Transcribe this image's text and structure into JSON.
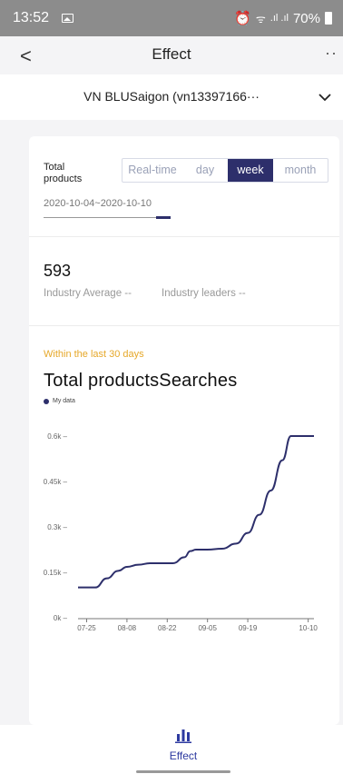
{
  "status_bar": {
    "time": "13:52",
    "battery": "70%"
  },
  "header": {
    "title": "Effect",
    "back_glyph": "<",
    "more_glyph": "··"
  },
  "store_selector": {
    "name": "VN BLUSaigon (vn13397166···"
  },
  "filter": {
    "label": "Total products",
    "tabs": [
      "Real-time",
      "day",
      "week",
      "month"
    ],
    "selected_tab": "week",
    "date_range": "2020-10-04~2020-10-10"
  },
  "stats": {
    "value": "593",
    "industry_average": "Industry Average --",
    "industry_leaders": "Industry leaders --"
  },
  "chart_section": {
    "period_note": "Within the last 30 days",
    "title": "Total productsSearches",
    "legend_label": "My data"
  },
  "chart_data": {
    "type": "line",
    "title": "Total productsSearches",
    "series": [
      {
        "name": "My data",
        "color": "#2d2f6b",
        "x": [
          "07-22",
          "07-25",
          "07-28",
          "08-01",
          "08-05",
          "08-08",
          "08-12",
          "08-16",
          "08-20",
          "08-24",
          "08-28",
          "08-30",
          "09-01",
          "09-05",
          "09-10",
          "09-15",
          "09-19",
          "09-23",
          "09-27",
          "10-01",
          "10-04",
          "10-07",
          "10-10",
          "10-12"
        ],
        "values": [
          100,
          100,
          100,
          130,
          155,
          168,
          175,
          180,
          180,
          180,
          200,
          220,
          225,
          225,
          228,
          245,
          280,
          340,
          420,
          520,
          600,
          600,
          600,
          600
        ]
      }
    ],
    "x_ticks": [
      "07-25",
      "08-08",
      "08-22",
      "09-05",
      "09-19",
      "10-10"
    ],
    "y_ticks": [
      "0k",
      "0.15k",
      "0.3k",
      "0.45k",
      "0.6k"
    ],
    "ylim": [
      0,
      600
    ],
    "grid": false
  },
  "bottom_nav": {
    "label": "Effect",
    "icon": "bar-chart-icon",
    "accent": "#2d3aa0"
  }
}
